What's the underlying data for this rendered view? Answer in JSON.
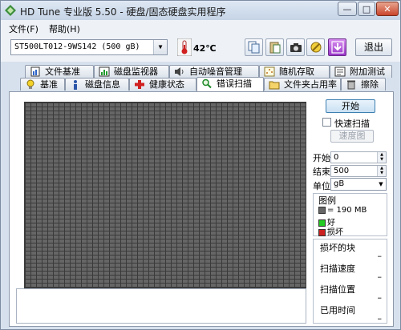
{
  "window": {
    "title": "HD Tune 专业版 5.50 - 硬盘/固态硬盘实用程序",
    "controls": {
      "minimize": "—",
      "maximize": "□",
      "close": "✕"
    }
  },
  "menu": [
    {
      "label": "文件(F)"
    },
    {
      "label": "帮助(H)"
    }
  ],
  "toolbar": {
    "drive": "ST500LT012-9WS142 (500 gB)",
    "temperature": "42℃",
    "exit_label": "退出",
    "icons": [
      "copy-icon",
      "paste-icon",
      "camera-icon",
      "tools-icon",
      "download-icon"
    ]
  },
  "tabs_row1": [
    {
      "label": "文件基准",
      "icon": "file-benchmark-icon"
    },
    {
      "label": "磁盘监视器",
      "icon": "disk-monitor-icon"
    },
    {
      "label": "自动噪音管理",
      "icon": "speaker-icon"
    },
    {
      "label": "随机存取",
      "icon": "random-access-icon"
    },
    {
      "label": "附加测试",
      "icon": "extra-tests-icon"
    }
  ],
  "tabs_row2": [
    {
      "label": "基准",
      "icon": "bulb-icon"
    },
    {
      "label": "磁盘信息",
      "icon": "info-icon"
    },
    {
      "label": "健康状态",
      "icon": "health-cross-icon"
    },
    {
      "label": "错误扫描",
      "icon": "magnifier-icon",
      "active": true
    },
    {
      "label": "文件夹占用率",
      "icon": "folder-icon"
    },
    {
      "label": "擦除",
      "icon": "trash-icon"
    }
  ],
  "scan": {
    "start_label": "开始",
    "quick_scan_label": "快速扫描",
    "quick_scan_checked": false,
    "speed_map_label": "速度图",
    "start_field_label": "开始",
    "start_value": "0",
    "end_field_label": "结束",
    "end_value": "500",
    "unit_label": "单位",
    "unit_value": "gB"
  },
  "legend": {
    "title": "图例",
    "block_label": "= 190 MB",
    "good_label": "好",
    "bad_label": "损坏",
    "colors": {
      "block": "#666666",
      "good": "#22cc22",
      "bad": "#cc2222"
    }
  },
  "stats": [
    {
      "label": "损坏的块",
      "value": "–"
    },
    {
      "label": "扫描速度",
      "value": "–"
    },
    {
      "label": "扫描位置",
      "value": "–"
    },
    {
      "label": "已用时间",
      "value": "–"
    }
  ]
}
